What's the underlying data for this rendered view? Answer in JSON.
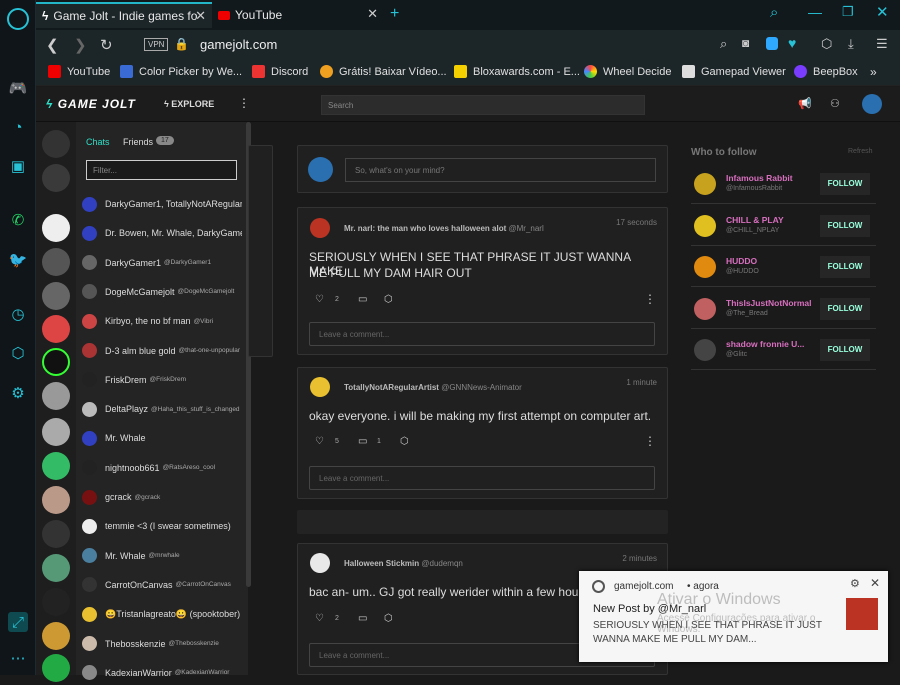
{
  "tabs": [
    {
      "label": "Game Jolt - Indie games fo",
      "active": true
    },
    {
      "label": "YouTube",
      "active": false
    }
  ],
  "address": {
    "vpn_label": "VPN",
    "url": "gamejolt.com"
  },
  "bookmarks": [
    {
      "label": "YouTube",
      "color": "#e00"
    },
    {
      "label": "Color Picker by We...",
      "color": "#3a6ad4"
    },
    {
      "label": "Discord",
      "color": "#e33"
    },
    {
      "label": "Grátis! Baixar Vídeo...",
      "color": "#f0a020"
    },
    {
      "label": "Bloxawards.com - E...",
      "color": "#f5d000"
    },
    {
      "label": "Wheel Decide",
      "color": "#ff5a5a"
    },
    {
      "label": "Gamepad Viewer",
      "color": "#ddd"
    },
    {
      "label": "BeepBox",
      "color": "#7a3cff"
    }
  ],
  "header": {
    "logo": "GAME JOLT",
    "explore_label": "EXPLORE",
    "search_placeholder": "Search"
  },
  "chat": {
    "tab_chats": "Chats",
    "tab_friends": "Friends",
    "friends_count": "17",
    "filter_placeholder": "Filter...",
    "rows": [
      {
        "name": "DarkyGamer1, TotallyNotARegularArt...",
        "user": "",
        "color": "#3040c0"
      },
      {
        "name": "Dr. Bowen, Mr. Whale, DarkyGamer...",
        "user": "",
        "color": "#3040c0"
      },
      {
        "name": "DarkyGamer1",
        "user": "@DarkyGamer1",
        "color": "#666"
      },
      {
        "name": "DogeMcGamejolt",
        "user": "@DogeMcGamejolt",
        "color": "#555"
      },
      {
        "name": "Kirbyo, the no bf man",
        "user": "@Vibri",
        "color": "#c44"
      },
      {
        "name": "D-3 alm blue gold",
        "user": "@that-one-unpopular",
        "color": "#a33"
      },
      {
        "name": "FriskDrem",
        "user": "@FriskDrem",
        "color": "#222"
      },
      {
        "name": "DeltaPlayz",
        "user": "@Haha_this_stuff_is_changed",
        "color": "#bbb"
      },
      {
        "name": "Mr. Whale",
        "user": "",
        "color": "#3040c0"
      },
      {
        "name": "nightnoob661",
        "user": "@RatsAreso_cool",
        "color": "#222"
      },
      {
        "name": "gcrack",
        "user": "@gcrack",
        "color": "#711"
      },
      {
        "name": "temmie <3 (I swear sometimes)",
        "user": "",
        "color": "#eee"
      },
      {
        "name": "Mr. Whale",
        "user": "@mrwhale",
        "color": "#4a7fa0"
      },
      {
        "name": "CarrotOnCanvas",
        "user": "@CarrotOnCanvas",
        "color": "#333"
      },
      {
        "name": "😀Tristanlagreato😀 (spooktober)",
        "user": "",
        "color": "#e8c030"
      },
      {
        "name": "Thebosskenzie",
        "user": "@Thebosskenzie",
        "color": "#cba"
      },
      {
        "name": "KadexianWarrior",
        "user": "@KadexianWarrior",
        "color": "#888"
      }
    ]
  },
  "composer": {
    "placeholder": "So, what's on your mind?"
  },
  "posts": [
    {
      "title": "Mr. narl: the man who loves halloween alot",
      "user": "@Mr_narl",
      "time": "17 seconds",
      "body_lines": [
        "SERIOUSLY WHEN I SEE THAT PHRASE IT JUST WANNA MAKE",
        "ME PULL MY DAM HAIR OUT"
      ],
      "likes": "2",
      "comments": "",
      "comment_placeholder": "Leave a comment..."
    },
    {
      "title": "TotallyNotARegularArtist",
      "user": "@GNNNews-Animator",
      "time": "1 minute",
      "body_lines": [
        "okay everyone. i will be making my first attempt on computer art."
      ],
      "likes": "5",
      "comments": "1",
      "comment_placeholder": "Leave a comment..."
    },
    {
      "title": "Halloween Stickmin",
      "user": "@dudemqn",
      "time": "2 minutes",
      "body_lines": [
        "bac an- um.. GJ got really werider within a few hours-"
      ],
      "likes": "2",
      "comments": "",
      "comment_placeholder": "Leave a comment..."
    }
  ],
  "follow": {
    "title": "Who to follow",
    "refresh": "Refresh",
    "button_label": "FOLLOW",
    "people": [
      {
        "name": "Infamous Rabbit",
        "user": "@InfamousRabbit",
        "color": "#c7a21e"
      },
      {
        "name": "CHILL & PLAY",
        "user": "@CHILL_NPLAY",
        "color": "#e0c020"
      },
      {
        "name": "HUDDO",
        "user": "@HUDDO",
        "color": "#e08a10"
      },
      {
        "name": "ThisIsJustNotNormal",
        "user": "@The_Bread",
        "color": "#c06060"
      },
      {
        "name": "shadow fronnie U...",
        "user": "@Glitc",
        "color": "#444"
      }
    ]
  },
  "toast": {
    "site": "gamejolt.com",
    "when": "• agora",
    "title": "New Post by @Mr_narl",
    "body": "SERIOUSLY WHEN I SEE THAT PHRASE IT JUST WANNA MAKE ME PULL MY DAM...",
    "watermark1": "Ativar o Windows",
    "watermark2": "Acesse Configurações para ativar o Windows."
  }
}
